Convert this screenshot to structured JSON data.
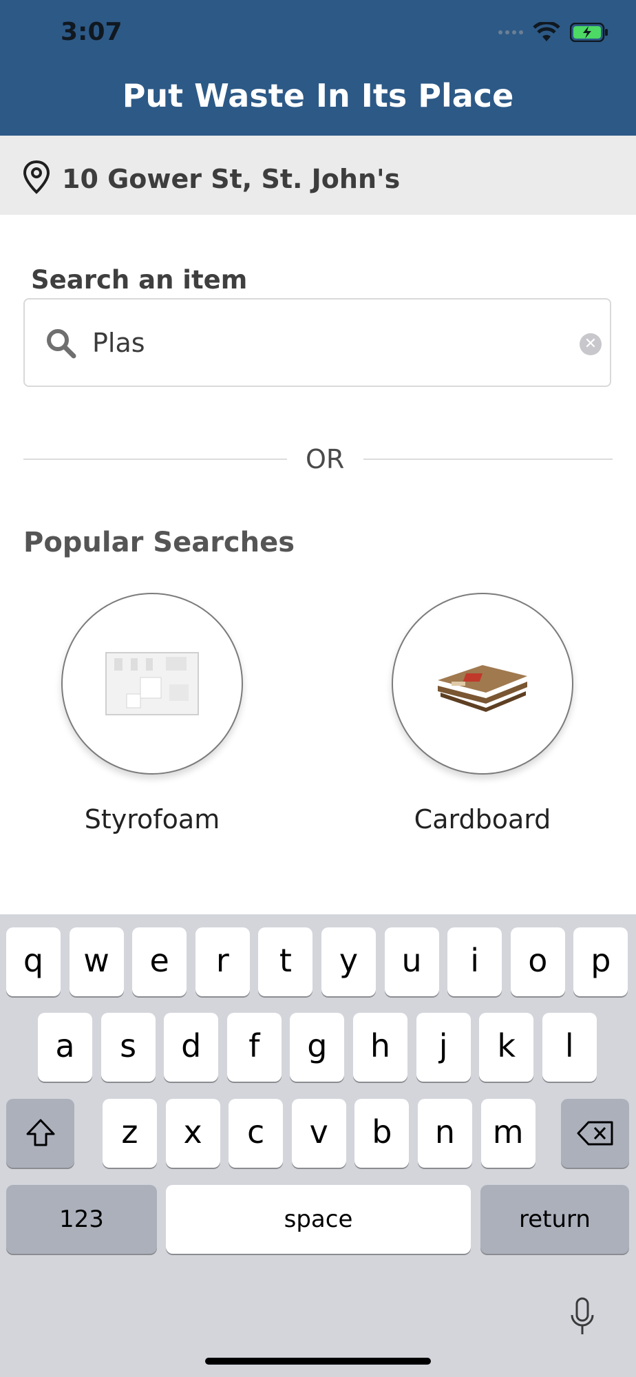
{
  "status_bar": {
    "time": "3:07"
  },
  "header": {
    "title": "Put Waste In Its Place"
  },
  "location": {
    "address": "10 Gower St, St. John's"
  },
  "search": {
    "label": "Search an item",
    "value": "Plas"
  },
  "divider": {
    "text": "OR"
  },
  "popular": {
    "title": "Popular Searches",
    "items": [
      {
        "label": "Styrofoam"
      },
      {
        "label": "Cardboard"
      }
    ]
  },
  "keyboard": {
    "row1": [
      "q",
      "w",
      "e",
      "r",
      "t",
      "y",
      "u",
      "i",
      "o",
      "p"
    ],
    "row2": [
      "a",
      "s",
      "d",
      "f",
      "g",
      "h",
      "j",
      "k",
      "l"
    ],
    "row3": [
      "z",
      "x",
      "c",
      "v",
      "b",
      "n",
      "m"
    ],
    "numbers_key": "123",
    "space_key": "space",
    "return_key": "return"
  },
  "colors": {
    "header": "#2d5986",
    "keyboard_bg": "#d3d5db",
    "battery": "#4cd964"
  }
}
